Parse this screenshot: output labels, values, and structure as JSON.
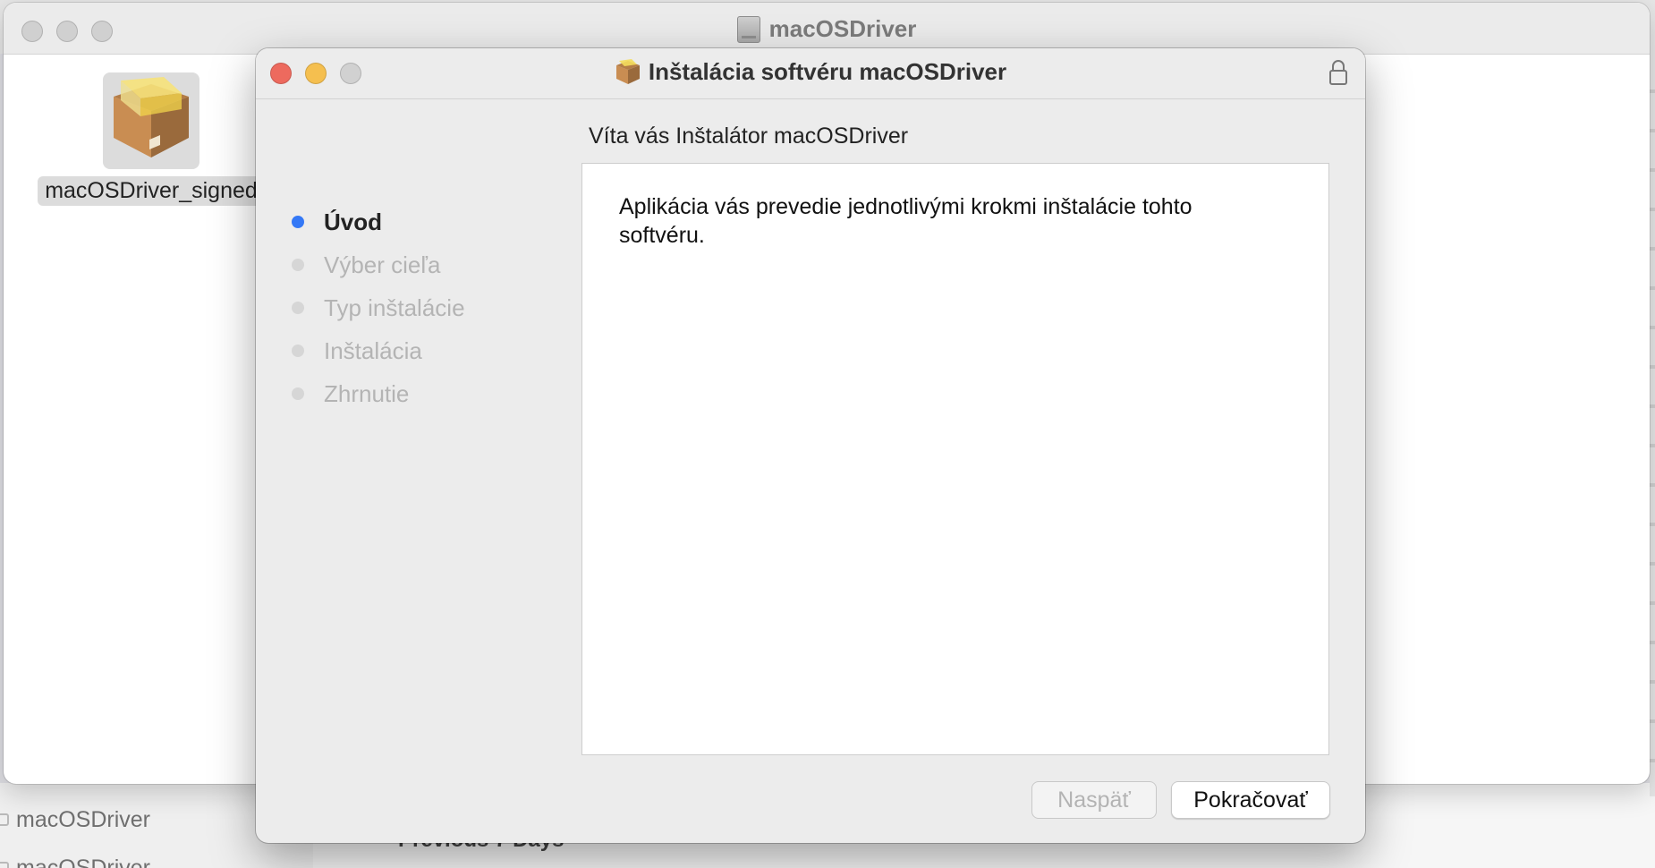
{
  "background": {
    "sidebar_items": [
      "macOSDriver",
      "macOSDriver"
    ],
    "section_label": "Previous 7 Days"
  },
  "dmg_window": {
    "title": "macOSDriver",
    "file_label": "macOSDriver_signed"
  },
  "installer": {
    "title": "Inštalácia softvéru macOSDriver",
    "heading": "Víta vás Inštalátor macOSDriver",
    "steps": [
      "Úvod",
      "Výber cieľa",
      "Typ inštalácie",
      "Inštalácia",
      "Zhrnutie"
    ],
    "active_step": 0,
    "body_text": "Aplikácia vás prevedie jednotlivými krokmi inštalácie tohto softvéru.",
    "buttons": {
      "back": "Naspäť",
      "continue": "Pokračovať"
    }
  },
  "icons": {
    "package": "package-icon",
    "lock": "lock-icon",
    "disk": "disk-image-icon"
  },
  "colors": {
    "close": "#ed6a5e",
    "minimize": "#f5bf4f",
    "zoom": "#d1d1d1",
    "active_step": "#3478f6"
  }
}
